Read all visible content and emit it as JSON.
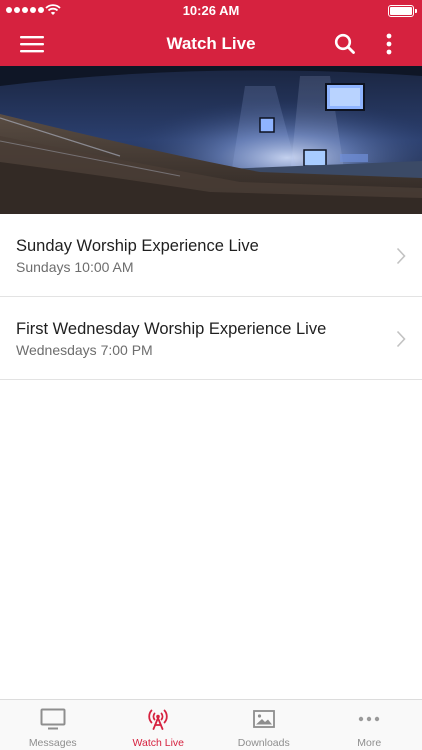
{
  "status_bar": {
    "time": "10:26 AM",
    "signal_icon": "signal-dots-icon",
    "wifi_icon": "wifi-icon",
    "battery_icon": "battery-icon"
  },
  "nav": {
    "title": "Watch Live",
    "menu_icon": "hamburger-menu-icon",
    "search_icon": "search-icon",
    "more_icon": "more-vertical-icon"
  },
  "theme": {
    "brand": "#d6223f",
    "tab_inactive": "#8e8e8e",
    "separator": "#e3e3e3"
  },
  "list": {
    "items": [
      {
        "title": "Sunday Worship Experience Live",
        "subtitle": "Sundays 10:00 AM"
      },
      {
        "title": "First Wednesday Worship Experience Live",
        "subtitle": "Wednesdays 7:00 PM"
      }
    ]
  },
  "tabs": [
    {
      "label": "Messages",
      "icon": "tv-icon",
      "active": false
    },
    {
      "label": "Watch Live",
      "icon": "broadcast-icon",
      "active": true
    },
    {
      "label": "Downloads",
      "icon": "image-icon",
      "active": false
    },
    {
      "label": "More",
      "icon": "more-horizontal-icon",
      "active": false
    }
  ]
}
